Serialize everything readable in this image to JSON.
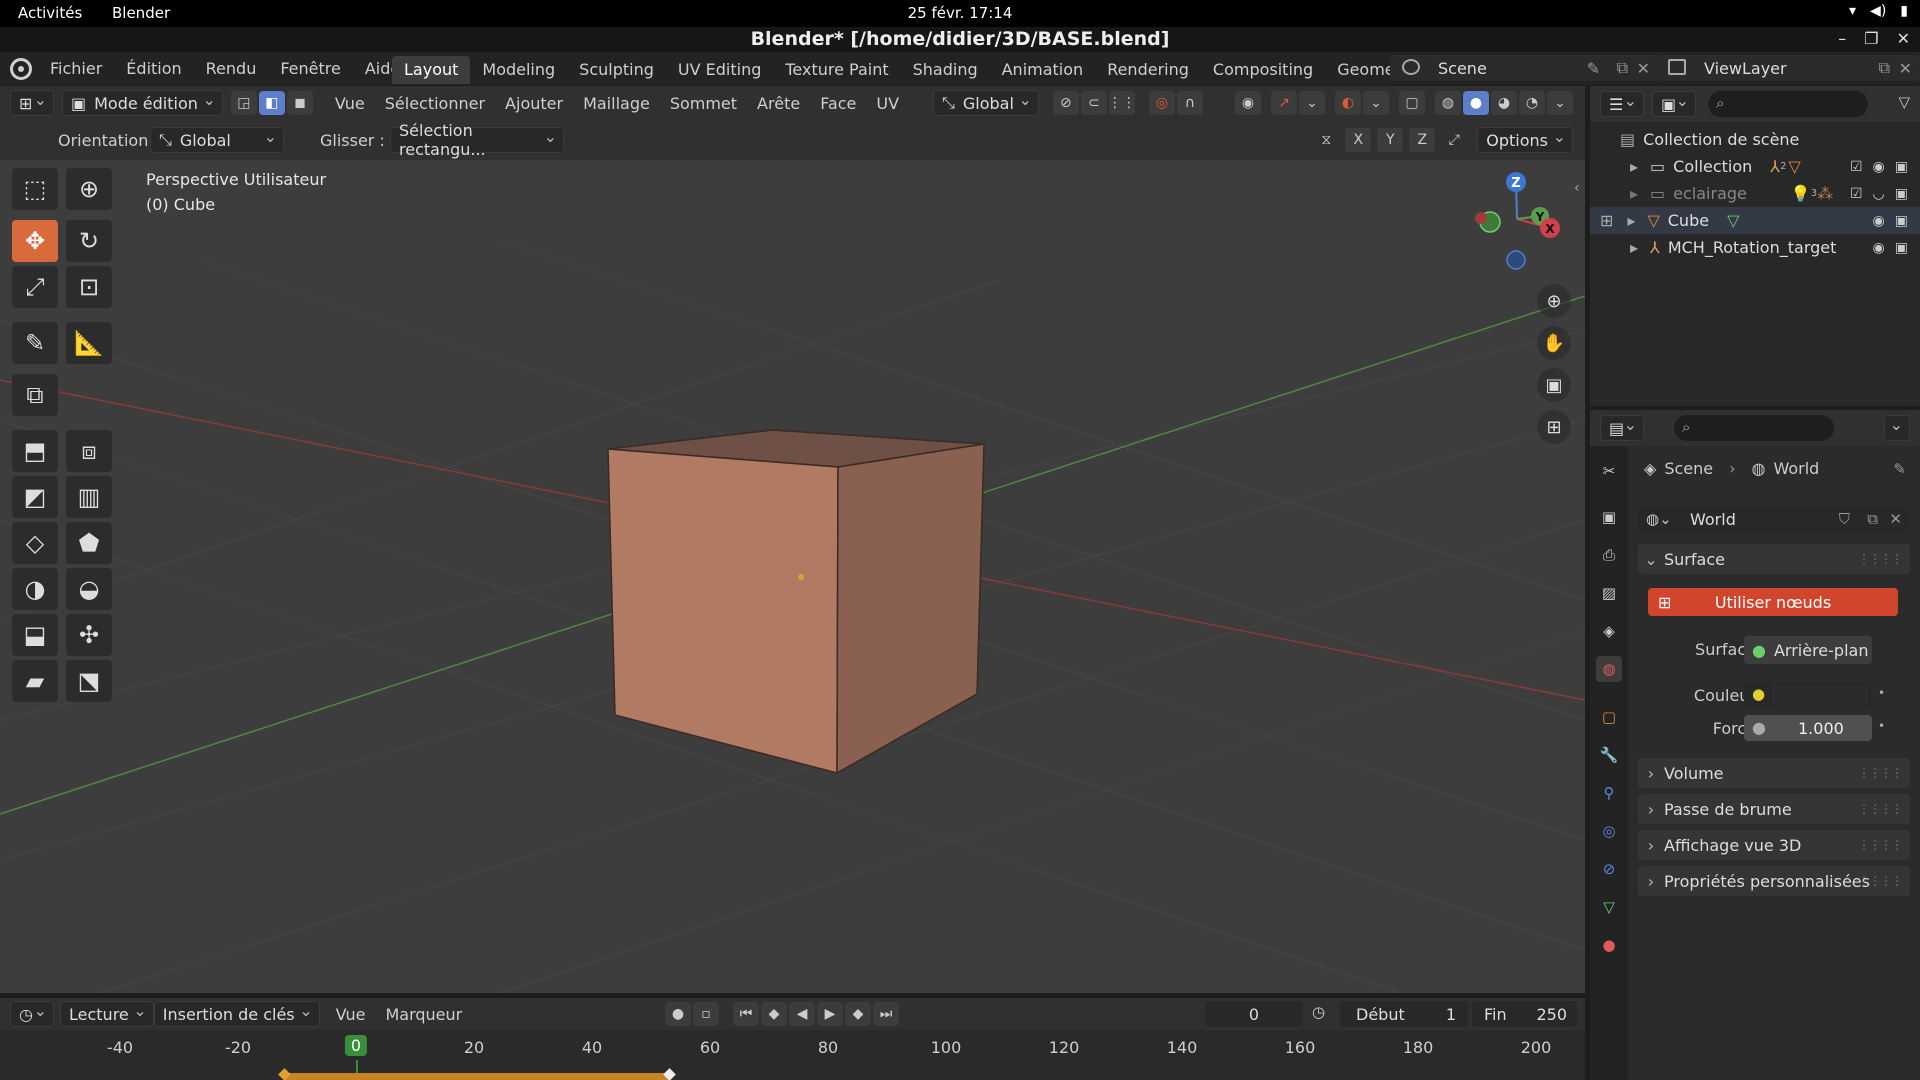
{
  "gnome": {
    "activities": "Activités",
    "app": "Blender",
    "clock": "25 févr.  17:14"
  },
  "window": {
    "title": "Blender* [/home/didier/3D/BASE.blend]"
  },
  "menu": [
    "Fichier",
    "Édition",
    "Rendu",
    "Fenêtre",
    "Aide"
  ],
  "workspaces": [
    "Layout",
    "Modeling",
    "Sculpting",
    "UV Editing",
    "Texture Paint",
    "Shading",
    "Animation",
    "Rendering",
    "Compositing",
    "Geometry N"
  ],
  "scene": "Scene",
  "view_layer": "ViewLayer",
  "viewport_header": {
    "mode": "Mode édition",
    "menus": [
      "Vue",
      "Sélectionner",
      "Ajouter",
      "Maillage",
      "Sommet",
      "Arête",
      "Face",
      "UV"
    ],
    "transform_orientation": "Global"
  },
  "tool_settings": {
    "orientation_label": "Orientation:",
    "orientation_value": "Global",
    "drag_label": "Glisser :",
    "drag_value": "Sélection rectangu...",
    "axes": [
      "X",
      "Y",
      "Z"
    ],
    "options": "Options"
  },
  "viewport": {
    "perspective": "Perspective Utilisateur",
    "object": "(0) Cube",
    "gizmo_axes": [
      "Z",
      "Y",
      "X"
    ]
  },
  "timeline": {
    "playback": "Lecture",
    "keying": "Insertion de clés",
    "view": "Vue",
    "marker": "Marqueur",
    "current_frame": "0",
    "start_label": "Début",
    "start": "1",
    "end_label": "Fin",
    "end": "250",
    "ticks": [
      "-40",
      "-20",
      "0",
      "20",
      "40",
      "60",
      "80",
      "100",
      "120",
      "140",
      "160",
      "180",
      "200"
    ]
  },
  "outliner": {
    "root": "Collection de scène",
    "items": [
      {
        "label": "Collection",
        "badge": "2"
      },
      {
        "label": "eclairage",
        "badge": "3"
      },
      {
        "label": "Cube",
        "badge": ""
      },
      {
        "label": "MCH_Rotation_target",
        "badge": ""
      }
    ]
  },
  "properties": {
    "breadcrumb_scene": "Scene",
    "breadcrumb_world": "World",
    "world_name": "World",
    "surface_panel": "Surface",
    "use_nodes": "Utiliser nœuds",
    "surface_label": "Surface",
    "surface_value": "Arrière-plan",
    "color_label": "Couleur",
    "strength_label": "Force",
    "strength_value": "1.000",
    "panels": [
      "Volume",
      "Passe de brume",
      "Affichage vue 3D",
      "Propriétés personnalisées"
    ]
  },
  "colors": {
    "accent": "#d86a3c",
    "active_blue": "#5d7ec9",
    "cube_front": "#b07a63",
    "cube_side": "#8a6150",
    "cube_top": "#6e5046"
  }
}
